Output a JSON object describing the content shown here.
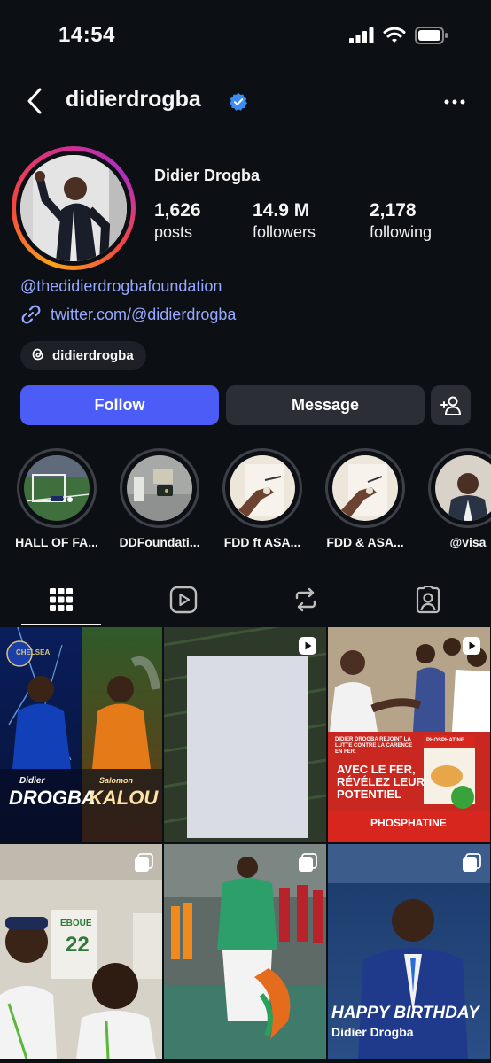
{
  "status_bar": {
    "time": "14:54",
    "icons": [
      "cellular-signal-icon",
      "wifi-icon",
      "battery-icon"
    ]
  },
  "header": {
    "username": "didierdrogba",
    "verified": true,
    "back_icon": "chevron-left-icon",
    "more_icon": "more-horizontal-icon"
  },
  "profile": {
    "display_name": "Didier Drogba",
    "stats": [
      {
        "value": "1,626",
        "label": "posts"
      },
      {
        "value": "14.9 M",
        "label": "followers"
      },
      {
        "value": "2,178",
        "label": "following"
      }
    ],
    "bio_mention": "@thedidierdrogbafoundation",
    "bio_link": "twitter.com/@didierdrogba",
    "threads_handle": "didierdrogba"
  },
  "actions": {
    "follow": "Follow",
    "message": "Message",
    "add_user_icon": "add-person-icon"
  },
  "highlights": [
    {
      "label": "HALL OF FA..."
    },
    {
      "label": "DDFoundati..."
    },
    {
      "label": "FDD ft ASA..."
    },
    {
      "label": "FDD & ASA..."
    },
    {
      "label": "@visa"
    }
  ],
  "tabs": [
    {
      "name": "grid",
      "icon": "grid-icon",
      "active": true
    },
    {
      "name": "reels",
      "icon": "reels-icon",
      "active": false
    },
    {
      "name": "reposts",
      "icon": "repost-icon",
      "active": false
    },
    {
      "name": "tagged",
      "icon": "tagged-person-icon",
      "active": false
    }
  ],
  "posts": [
    {
      "kind": "image",
      "overlay": {
        "left_name": "DROGBA",
        "left_first": "Didier",
        "right_name": "KALOU",
        "right_first": "Salomon",
        "logo_text": "CHELSEA"
      }
    },
    {
      "kind": "reel"
    },
    {
      "kind": "reel",
      "overlay": {
        "headline": "AVEC LE FER, RÉVÉLEZ LEUR POTENTIEL",
        "brand": "PHOSPHATINE",
        "box_brand": "PHOSPHATINE",
        "tagline": "DIDIER DROGBA REJOINT LA LUTTE CONTRE LA CARENCE EN FER."
      }
    },
    {
      "kind": "carousel",
      "overlay": {
        "jersey_name": "EBOUE",
        "jersey_number": "22"
      }
    },
    {
      "kind": "carousel"
    },
    {
      "kind": "carousel",
      "overlay": {
        "title": "HAPPY BIRTHDAY",
        "subtitle": "Didier Drogba"
      }
    }
  ],
  "colors": {
    "background": "#0c0f14",
    "follow_button": "#4c5cf7",
    "secondary_button": "#2b2e34",
    "link": "#97a8ff",
    "verified": "#3b8cf5"
  }
}
